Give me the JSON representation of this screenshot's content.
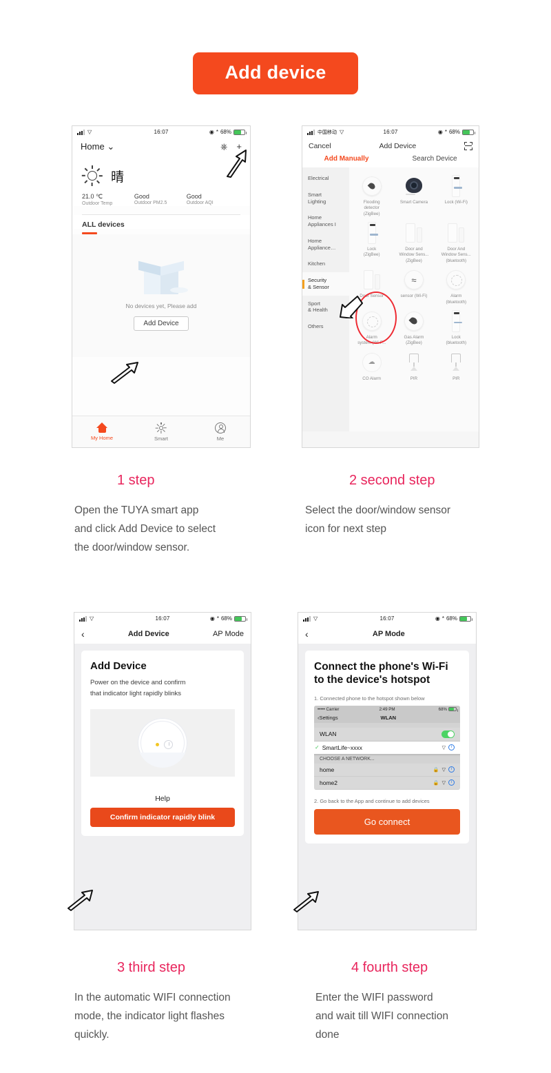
{
  "banner": {
    "title": "Add device"
  },
  "screen1": {
    "status": {
      "time": "16:07",
      "battery": "68%"
    },
    "home_label": "Home",
    "mic_icon": "microphone-icon",
    "add_icon": "+",
    "weather": {
      "condition": "晴"
    },
    "metrics": [
      {
        "value": "21.0 ℃",
        "label": "Outdoor Temp"
      },
      {
        "value": "Good",
        "label": "Outdoor PM2.5"
      },
      {
        "value": "Good",
        "label": "Outdoor AQI"
      }
    ],
    "devices_tab": "ALL devices",
    "empty_text": "No devices yet, Please add",
    "add_device_button": "Add Device",
    "tabs": [
      {
        "label": "My Home",
        "icon": "house-icon"
      },
      {
        "label": "Smart",
        "icon": "sun-icon"
      },
      {
        "label": "Me",
        "icon": "person-icon"
      }
    ]
  },
  "screen2": {
    "status": {
      "carrier": "中国移动",
      "time": "16:07",
      "battery": "68%"
    },
    "nav": {
      "cancel": "Cancel",
      "title": "Add Device",
      "scan_icon": "scan-icon"
    },
    "tabs": [
      {
        "label": "Add Manually",
        "active": true
      },
      {
        "label": "Search Device",
        "active": false
      }
    ],
    "categories": [
      {
        "label": "Electrical",
        "active": false
      },
      {
        "label": "Smart\nLighting",
        "active": false
      },
      {
        "label": "Home\nAppliances I",
        "active": false
      },
      {
        "label": "Home\nAppliance…",
        "active": false
      },
      {
        "label": "Kitchen",
        "active": false
      },
      {
        "label": "Security\n& Sensor",
        "active": true
      },
      {
        "label": "Sport\n& Health",
        "active": false
      },
      {
        "label": "Others",
        "active": false
      }
    ],
    "devices": [
      {
        "label": "Flooding\ndetector\n(ZigBee)",
        "icon": "flooding-detector-icon"
      },
      {
        "label": "Smart Camera",
        "icon": "camera-icon"
      },
      {
        "label": "Lock (Wi-Fi)",
        "icon": "lock-icon"
      },
      {
        "label": "Lock\n(ZigBee)",
        "icon": "lock-icon"
      },
      {
        "label": "Door and\nWindow Sens...\n(ZigBee)",
        "icon": "door-window-sensor-icon"
      },
      {
        "label": "Door And\nWindow Sens...\n(bluetooth)",
        "icon": "door-window-sensor-icon"
      },
      {
        "label": "Door Sensor",
        "icon": "door-sensor-icon"
      },
      {
        "label": "sensor (Wi-Fi)",
        "icon": "wave-sensor-icon"
      },
      {
        "label": "Alarm\n(bluetooth)",
        "icon": "smoke-alarm-icon"
      },
      {
        "label": "Alarm\nsystem (Wi-F...",
        "icon": "smoke-alarm-icon"
      },
      {
        "label": "Gas Alarm\n(ZigBee)",
        "icon": "gas-alarm-icon"
      },
      {
        "label": "Lock\n(bluetooth)",
        "icon": "lock-icon"
      },
      {
        "label": "CO Alarm",
        "icon": "co-alarm-icon"
      },
      {
        "label": "PIR",
        "icon": "pir-icon"
      },
      {
        "label": "PIR",
        "icon": "pir-icon"
      }
    ]
  },
  "screen3": {
    "status": {
      "time": "16:07",
      "battery": "68%"
    },
    "nav": {
      "back_icon": "chevron-left-icon",
      "title": "Add Device",
      "right": "AP Mode"
    },
    "card": {
      "heading": "Add Device",
      "line1": "Power on the device and confirm",
      "line2": "that indicator light rapidly blinks"
    },
    "help_label": "Help",
    "cta": "Confirm indicator rapidly blink"
  },
  "screen4": {
    "status": {
      "time": "16:07",
      "battery": "68%"
    },
    "nav": {
      "back_icon": "chevron-left-icon",
      "title": "AP Mode"
    },
    "card": {
      "heading": "Connect the phone's Wi-Fi to the device's hotspot",
      "step1": "1. Connected phone to the hotspot shown below",
      "step2": "2. Go back to the App and continue to add devices"
    },
    "wlan_mock": {
      "status": {
        "carrier": "••••• Carrier",
        "time": "2:49 PM",
        "battery": "68%"
      },
      "nav": {
        "back": "Settings",
        "title": "WLAN"
      },
      "wlan_row": {
        "label": "WLAN",
        "toggle_on": true
      },
      "selected_network": {
        "name": "SmartLife~xxxx",
        "checked": true
      },
      "group_header": "CHOOSE A NETWORK...",
      "networks": [
        {
          "name": "home",
          "locked": true
        },
        {
          "name": "home2",
          "locked": true
        }
      ]
    },
    "cta": "Go connect"
  },
  "captions": [
    {
      "title": "1 step",
      "lines": [
        "Open the TUYA smart app",
        "and click Add Device to select",
        "the door/window sensor."
      ]
    },
    {
      "title": "2 second step",
      "lines": [
        "Select the door/window sensor",
        "icon for next step",
        ""
      ]
    },
    {
      "title": "3 third step",
      "lines": [
        "In the automatic WIFI connection",
        "mode, the indicator light flashes",
        "quickly."
      ]
    },
    {
      "title": "4 fourth step",
      "lines": [
        "Enter the WIFI password",
        "and wait till WIFI connection",
        "done"
      ]
    }
  ],
  "colors": {
    "accent_orange": "#F4491E",
    "step_pink": "#E8255C",
    "highlight_red": "#EE2B33",
    "toggle_green": "#4CD464"
  }
}
